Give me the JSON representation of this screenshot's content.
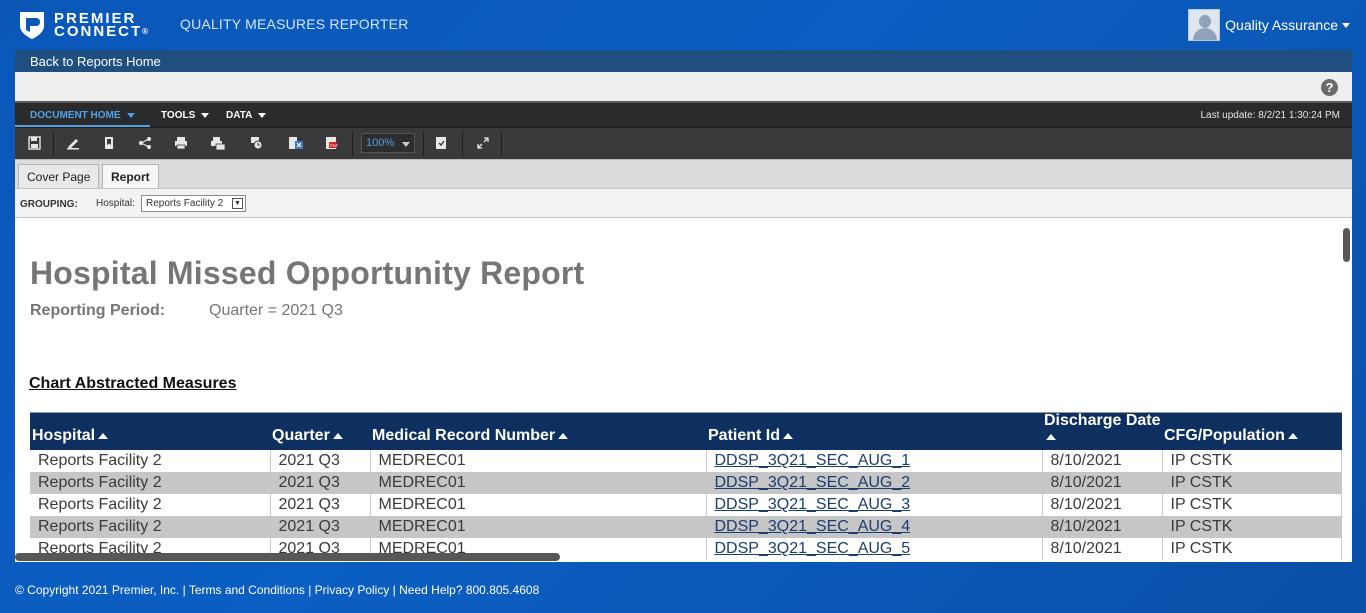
{
  "header": {
    "logo_line1": "PREMIER",
    "logo_line2": "CONNECT",
    "logo_reg": "®",
    "app_title": "QUALITY MEASURES REPORTER",
    "user_name": "Quality Assurance"
  },
  "nav": {
    "back_label": "Back to Reports Home"
  },
  "menu": {
    "items": [
      "DOCUMENT HOME",
      "TOOLS",
      "DATA"
    ],
    "last_update": "Last update: 8/2/21 1:30:24 PM"
  },
  "toolbar": {
    "zoom": "100%",
    "icons": [
      "save-icon",
      "edit-icon",
      "bookmark-icon",
      "share-icon",
      "print-icon",
      "print-all-icon",
      "schedule-icon",
      "export-excel-icon",
      "export-pdf-icon",
      "refresh-data-icon",
      "fullscreen-icon"
    ]
  },
  "tabs": [
    "Cover Page",
    "Report"
  ],
  "grouping": {
    "label": "GROUPING:",
    "hospital_label": "Hospital:",
    "hospital_value": "Reports Facility 2"
  },
  "report": {
    "title": "Hospital Missed Opportunity Report",
    "period_label": "Reporting Period:",
    "period_value": "Quarter = 2021 Q3",
    "section_title": "Chart Abstracted Measures",
    "columns": [
      "Hospital",
      "Quarter",
      "Medical Record Number",
      "Patient Id",
      "Discharge Date",
      "CFG/Population"
    ],
    "rows": [
      [
        "Reports Facility 2",
        "2021 Q3",
        "MEDREC01",
        "DDSP_3Q21_SEC_AUG_1",
        "8/10/2021",
        "IP CSTK"
      ],
      [
        "Reports Facility 2",
        "2021 Q3",
        "MEDREC01",
        "DDSP_3Q21_SEC_AUG_2",
        "8/10/2021",
        "IP CSTK"
      ],
      [
        "Reports Facility 2",
        "2021 Q3",
        "MEDREC01",
        "DDSP_3Q21_SEC_AUG_3",
        "8/10/2021",
        "IP CSTK"
      ],
      [
        "Reports Facility 2",
        "2021 Q3",
        "MEDREC01",
        "DDSP_3Q21_SEC_AUG_4",
        "8/10/2021",
        "IP CSTK"
      ],
      [
        "Reports Facility 2",
        "2021 Q3",
        "MEDREC01",
        "DDSP_3Q21_SEC_AUG_5",
        "8/10/2021",
        "IP CSTK"
      ]
    ]
  },
  "footer": {
    "text": "© Copyright 2021 Premier, Inc. | Terms and Conditions | Privacy Policy | Need Help? 800.805.4608"
  }
}
